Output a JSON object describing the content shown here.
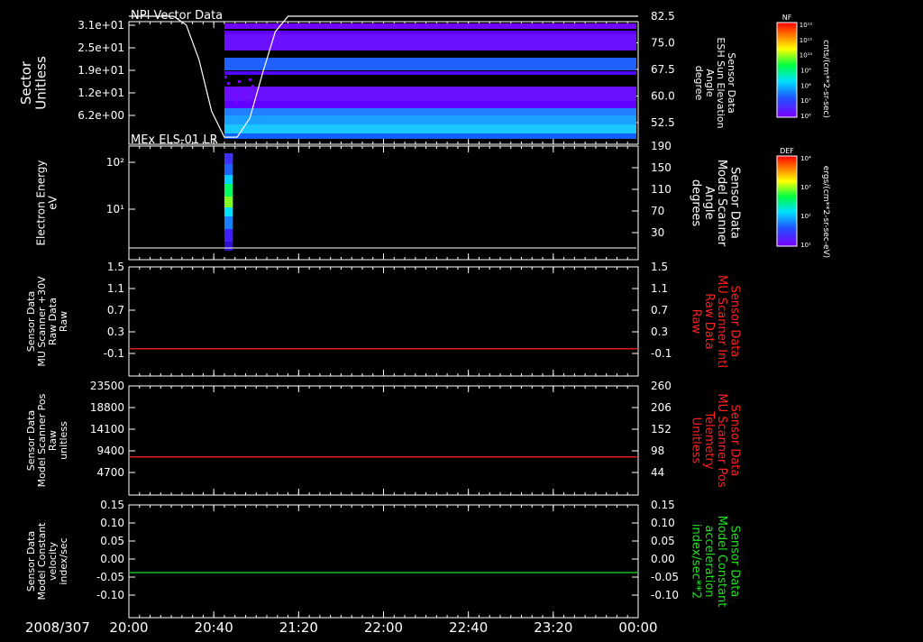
{
  "date": "2008/307",
  "x_tick_labels": [
    "20:00",
    "20:40",
    "21:20",
    "22:00",
    "22:40",
    "23:20",
    "00:00"
  ],
  "colors": {
    "white": "#ffffff",
    "red": "#ff2020",
    "green": "#20e020",
    "bg": "#000000"
  },
  "colorbars": [
    {
      "title": "NF",
      "unit": "cnts/(cm**2-sr-sec)",
      "ticks": [
        "10¹²",
        "10¹¹",
        "10¹⁰",
        "10⁹",
        "10⁸",
        "10⁷",
        "10⁶"
      ]
    },
    {
      "title": "DEF",
      "unit": "ergs/(cm**2-sr-sec-eV)",
      "ticks": [
        "10⁴",
        "10³",
        "10²",
        "10¹"
      ]
    }
  ],
  "chart_data": [
    {
      "type": "heatmap",
      "title": "NPI Vector Data",
      "ylabel": [
        "Sector",
        "Unitless"
      ],
      "y_ticks": [
        "3.1e+01",
        "2.5e+01",
        "1.9e+01",
        "1.2e+01",
        "6.2e+00"
      ],
      "right_label": [
        "Sensor Data",
        "ESH Sun Elevation",
        "Angle",
        "degree"
      ],
      "right_label_color": "#ffffff",
      "right_ticks": [
        "82.5",
        "75.0",
        "67.5",
        "60.0",
        "52.5"
      ],
      "right_ylim": [
        47,
        82.5
      ],
      "data_start": "20:45",
      "overlay_line": {
        "x": [
          "20:00",
          "20:21",
          "20:27",
          "20:33",
          "20:39",
          "20:45",
          "20:51",
          "20:57",
          "21:03",
          "21:09",
          "21:15",
          "00:00"
        ],
        "y": [
          82.5,
          82.5,
          80,
          70,
          55,
          47.5,
          47.5,
          53,
          66,
          78,
          82.5,
          82.5
        ]
      }
    },
    {
      "type": "heatmap",
      "title": "MEx ELS-01 LR",
      "ylabel": [
        "Electron Energy",
        "eV"
      ],
      "y_ticks": [
        "10²",
        "10¹"
      ],
      "right_label": [
        "Sensor Data",
        "Model Scanner",
        "Angle",
        "degrees"
      ],
      "right_label_color": "#ffffff",
      "right_ticks": [
        "190",
        "150",
        "110",
        "70",
        "30"
      ],
      "right_ylim": [
        -5,
        190
      ],
      "data_x": [
        "20:45",
        "20:49"
      ],
      "overlay_line": {
        "x": [
          "20:00",
          "00:00"
        ],
        "y": [
          0,
          0
        ]
      }
    },
    {
      "type": "line",
      "ylabel": [
        "Sensor Data",
        "MU Scanner +30V",
        "Raw Data",
        "Raw"
      ],
      "y_ticks": [
        "1.5",
        "1.1",
        "0.7",
        "0.3",
        "-0.1"
      ],
      "ylim": [
        -0.3,
        1.5
      ],
      "right_label": [
        "Sensor Data",
        "MU Scanner Intl",
        "Raw Data",
        "Raw"
      ],
      "right_label_color": "#ff2020",
      "right_ticks": [
        "1.5",
        "1.1",
        "0.7",
        "0.3",
        "-0.1"
      ],
      "series": [
        {
          "x": [
            "20:00",
            "00:00"
          ],
          "y": [
            0.0,
            0.0
          ],
          "color": "#ff2020"
        }
      ]
    },
    {
      "type": "line",
      "ylabel": [
        "Sensor Data",
        "Model Scanner Pos",
        "Raw",
        "unitless"
      ],
      "y_ticks": [
        "23500",
        "18800",
        "14100",
        "9400",
        "4700"
      ],
      "ylim": [
        0,
        23500
      ],
      "right_label": [
        "Sensor Data",
        "MU Scanner Pos",
        "Telemetry",
        "Unitless"
      ],
      "right_label_color": "#ff2020",
      "right_ticks": [
        "260",
        "206",
        "152",
        "98",
        "44"
      ],
      "series": [
        {
          "x": [
            "20:00",
            "00:00"
          ],
          "y": [
            8200,
            8200
          ],
          "color": "#ff2020"
        }
      ]
    },
    {
      "type": "line",
      "ylabel": [
        "Sensor Data",
        "Model Constant",
        "velocity",
        "index/sec"
      ],
      "y_ticks": [
        "0.15",
        "0.10",
        "0.05",
        "0.00",
        "-0.05",
        "-0.10"
      ],
      "ylim": [
        -0.1,
        0.15
      ],
      "right_label": [
        "Sensor Data",
        "Model Constant",
        "acceleration",
        "index/sec**2"
      ],
      "right_label_color": "#20e020",
      "right_ticks": [
        "0.15",
        "0.10",
        "0.05",
        "0.00",
        "-0.05",
        "-0.10"
      ],
      "series": [
        {
          "x": [
            "20:00",
            "00:00"
          ],
          "y": [
            0.0,
            0.0
          ],
          "color": "#20e020"
        }
      ]
    }
  ]
}
